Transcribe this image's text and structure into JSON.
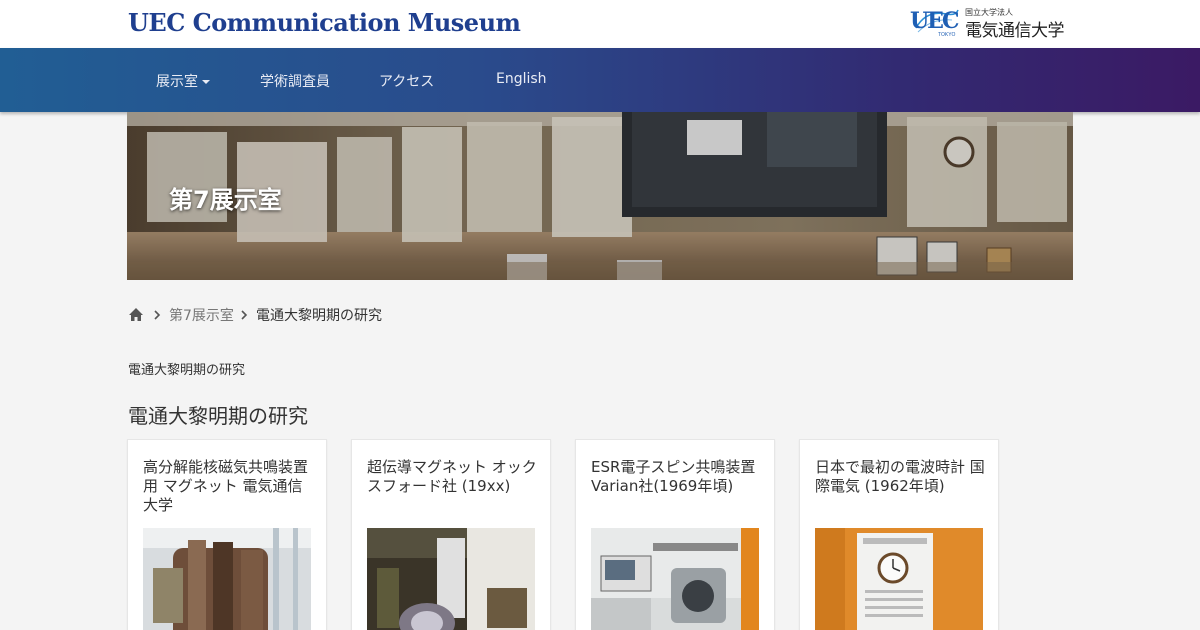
{
  "header": {
    "site_title": "UEC Communication Museum",
    "university_logo_mark": "UEC",
    "university_logo_sub": "TOKYO",
    "university_small": "国立大学法人",
    "university_name": "電気通信大学"
  },
  "nav": {
    "items": [
      {
        "label": "展示室",
        "has_dropdown": true
      },
      {
        "label": "学術調査員"
      },
      {
        "label": "アクセス"
      },
      {
        "label": "English"
      }
    ]
  },
  "hero": {
    "title": "第7展示室"
  },
  "breadcrumb": {
    "home_icon": "home-icon",
    "items": [
      "第7展示室",
      "電通大黎明期の研究"
    ]
  },
  "page": {
    "small_label": "電通大黎明期の研究",
    "heading": "電通大黎明期の研究"
  },
  "cards": [
    {
      "title": "高分解能核磁気共鳴装置用 マグネット 電気通信大学"
    },
    {
      "title": "超伝導マグネット オックスフォード社 (19xx)"
    },
    {
      "title": "ESR電子スピン共鳴装置 Varian社(1969年頃)"
    },
    {
      "title": "日本で最初の電波時計 国際電気 (1962年頃)"
    }
  ],
  "colors": {
    "site_title": "#1f3f8f",
    "nav_gradient_start": "#215e94",
    "nav_gradient_end": "#3b1a64",
    "background": "#f4f4f4"
  }
}
